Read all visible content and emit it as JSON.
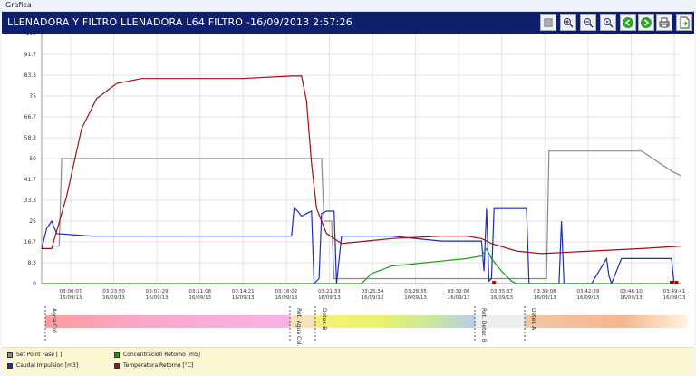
{
  "window_title": "Grafica",
  "header_title": "LLENADORA Y FILTRO LLENADORA L64  FILTRO -16/09/2013 2:57:26",
  "toolbar_icons": [
    "data-icon",
    "zoom-in-icon",
    "zoom-out-icon",
    "zoom-reset-icon",
    "back-icon",
    "forward-icon",
    "print-icon",
    "export-icon"
  ],
  "colors": {
    "header_bg": "#0e1f6c",
    "set_point": "#8a8a8a",
    "caudal": "#1c2fb8",
    "concentracion": "#11a011",
    "temperatura": "#a01010",
    "legend_bg": "#fdf6d3"
  },
  "chart_data": {
    "type": "line",
    "y_ticks": [
      "0",
      "8.3",
      "16.7",
      "25",
      "33.3",
      "41.7",
      "50",
      "58.3",
      "66.7",
      "75",
      "83.3",
      "91.7",
      "100"
    ],
    "ylim": [
      0,
      100
    ],
    "x_ticks": [
      {
        "time": "03:00:07",
        "date": "16/09/13"
      },
      {
        "time": "03:03:50",
        "date": "16/09/13"
      },
      {
        "time": "03:07:29",
        "date": "16/09/13"
      },
      {
        "time": "03:11:08",
        "date": "16/09/13"
      },
      {
        "time": "03:14:21",
        "date": "16/09/13"
      },
      {
        "time": "03:18:02",
        "date": "16/09/13"
      },
      {
        "time": "03:21:33",
        "date": "16/09/13"
      },
      {
        "time": "03:25:34",
        "date": "16/09/13"
      },
      {
        "time": "03:28:35",
        "date": "16/09/13"
      },
      {
        "time": "03:32:06",
        "date": "16/09/13"
      },
      {
        "time": "03:35:37",
        "date": "16/09/13"
      },
      {
        "time": "03:39:08",
        "date": "16/09/13"
      },
      {
        "time": "03:42:39",
        "date": "16/09/13"
      },
      {
        "time": "03:46:10",
        "date": "16/09/13"
      },
      {
        "time": "03:49:41",
        "date": "16/09/13"
      }
    ],
    "grid": true,
    "series": [
      {
        "name": "Set Point Fase [ ]",
        "color": "#8a8a8a",
        "points": [
          [
            0.02,
            15
          ],
          [
            0.035,
            15
          ],
          [
            0.04,
            50
          ],
          [
            0.56,
            50
          ],
          [
            0.565,
            25
          ],
          [
            0.58,
            25
          ],
          [
            0.585,
            2
          ],
          [
            0.9,
            2
          ],
          [
            0.905,
            2
          ],
          [
            1.01,
            2
          ],
          [
            1.015,
            53
          ],
          [
            1.2,
            53
          ],
          [
            1.26,
            45
          ],
          [
            1.28,
            43
          ]
        ]
      },
      {
        "name": "Caudal Impulsion [m3]",
        "color": "#1c2fb8",
        "points": [
          [
            0.0,
            14
          ],
          [
            0.01,
            22
          ],
          [
            0.02,
            25
          ],
          [
            0.03,
            20
          ],
          [
            0.1,
            19
          ],
          [
            0.2,
            19
          ],
          [
            0.3,
            19
          ],
          [
            0.4,
            19
          ],
          [
            0.5,
            19
          ],
          [
            0.505,
            30
          ],
          [
            0.51,
            29.5
          ],
          [
            0.52,
            27
          ],
          [
            0.53,
            28
          ],
          [
            0.54,
            29
          ],
          [
            0.545,
            0
          ],
          [
            0.555,
            2
          ],
          [
            0.56,
            28
          ],
          [
            0.57,
            29
          ],
          [
            0.585,
            29
          ],
          [
            0.59,
            0
          ],
          [
            0.6,
            19
          ],
          [
            0.7,
            19
          ],
          [
            0.8,
            17
          ],
          [
            0.88,
            17
          ],
          [
            0.885,
            5
          ],
          [
            0.89,
            30
          ],
          [
            0.895,
            1
          ],
          [
            0.9,
            2
          ],
          [
            0.905,
            30
          ],
          [
            0.92,
            30
          ],
          [
            0.96,
            30
          ],
          [
            0.97,
            30
          ],
          [
            0.975,
            0
          ],
          [
            1.035,
            0
          ],
          [
            1.04,
            25
          ],
          [
            1.045,
            0
          ],
          [
            1.1,
            0
          ],
          [
            1.13,
            10
          ],
          [
            1.135,
            3
          ],
          [
            1.14,
            0
          ],
          [
            1.16,
            10
          ],
          [
            1.2,
            10
          ],
          [
            1.26,
            10
          ],
          [
            1.265,
            0
          ]
        ]
      },
      {
        "name": "Concentracion Retorno [mS]",
        "color": "#11a011",
        "points": [
          [
            0.0,
            0
          ],
          [
            0.64,
            0
          ],
          [
            0.66,
            4
          ],
          [
            0.7,
            7
          ],
          [
            0.75,
            8
          ],
          [
            0.8,
            9
          ],
          [
            0.85,
            10
          ],
          [
            0.88,
            11
          ],
          [
            0.89,
            14
          ],
          [
            0.9,
            10
          ],
          [
            0.92,
            5
          ],
          [
            0.94,
            1
          ],
          [
            0.95,
            0
          ],
          [
            1.28,
            0
          ]
        ]
      },
      {
        "name": "Temperatura Retorno [°C]",
        "color": "#a01010",
        "points": [
          [
            0.0,
            14
          ],
          [
            0.02,
            14
          ],
          [
            0.05,
            35
          ],
          [
            0.08,
            62
          ],
          [
            0.11,
            74
          ],
          [
            0.15,
            80
          ],
          [
            0.2,
            82
          ],
          [
            0.3,
            82
          ],
          [
            0.4,
            82
          ],
          [
            0.5,
            83
          ],
          [
            0.52,
            83
          ],
          [
            0.53,
            73
          ],
          [
            0.54,
            48
          ],
          [
            0.55,
            30
          ],
          [
            0.57,
            20
          ],
          [
            0.6,
            16
          ],
          [
            0.65,
            17
          ],
          [
            0.7,
            18
          ],
          [
            0.8,
            19
          ],
          [
            0.85,
            19
          ],
          [
            0.88,
            18
          ],
          [
            0.9,
            16
          ],
          [
            0.95,
            13
          ],
          [
            1.0,
            12
          ],
          [
            1.1,
            13
          ],
          [
            1.2,
            14
          ],
          [
            1.28,
            15
          ]
        ]
      }
    ]
  },
  "phases": [
    {
      "label": "Agua Col"
    },
    {
      "label": "Ret. Agua Col."
    },
    {
      "label": "Deter. B"
    },
    {
      "label": "Ret. Deter. B"
    },
    {
      "label": "Deter. A"
    }
  ],
  "legend": [
    {
      "label": "Set Point Fase [ ]",
      "color": "#8a8a8a"
    },
    {
      "label": "Caudal Impulsion [m3]",
      "color": "#1c2fb8"
    },
    {
      "label": "Concentracion Retorno [mS]",
      "color": "#11a011"
    },
    {
      "label": "Temperatura Retorno [°C]",
      "color": "#a01010"
    }
  ]
}
